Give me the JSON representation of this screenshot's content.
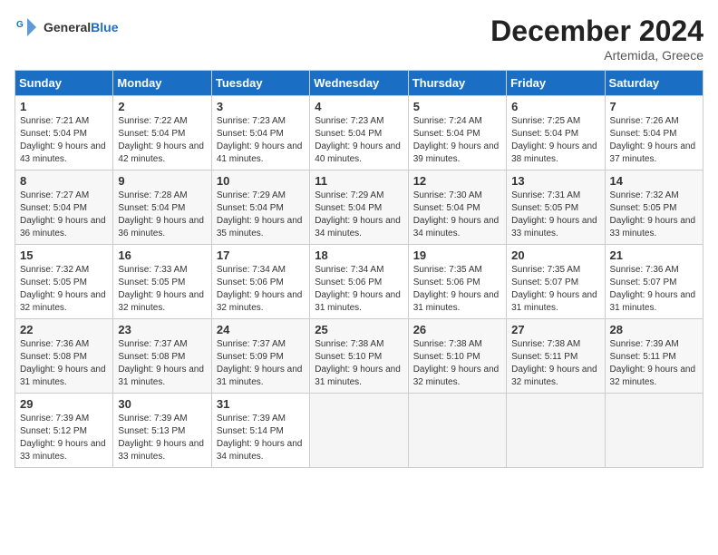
{
  "logo": {
    "text_general": "General",
    "text_blue": "Blue"
  },
  "title": "December 2024",
  "location": "Artemida, Greece",
  "days_of_week": [
    "Sunday",
    "Monday",
    "Tuesday",
    "Wednesday",
    "Thursday",
    "Friday",
    "Saturday"
  ],
  "weeks": [
    [
      {
        "day": "1",
        "sunrise": "7:21 AM",
        "sunset": "5:04 PM",
        "daylight": "9 hours and 43 minutes."
      },
      {
        "day": "2",
        "sunrise": "7:22 AM",
        "sunset": "5:04 PM",
        "daylight": "9 hours and 42 minutes."
      },
      {
        "day": "3",
        "sunrise": "7:23 AM",
        "sunset": "5:04 PM",
        "daylight": "9 hours and 41 minutes."
      },
      {
        "day": "4",
        "sunrise": "7:23 AM",
        "sunset": "5:04 PM",
        "daylight": "9 hours and 40 minutes."
      },
      {
        "day": "5",
        "sunrise": "7:24 AM",
        "sunset": "5:04 PM",
        "daylight": "9 hours and 39 minutes."
      },
      {
        "day": "6",
        "sunrise": "7:25 AM",
        "sunset": "5:04 PM",
        "daylight": "9 hours and 38 minutes."
      },
      {
        "day": "7",
        "sunrise": "7:26 AM",
        "sunset": "5:04 PM",
        "daylight": "9 hours and 37 minutes."
      }
    ],
    [
      {
        "day": "8",
        "sunrise": "7:27 AM",
        "sunset": "5:04 PM",
        "daylight": "9 hours and 36 minutes."
      },
      {
        "day": "9",
        "sunrise": "7:28 AM",
        "sunset": "5:04 PM",
        "daylight": "9 hours and 36 minutes."
      },
      {
        "day": "10",
        "sunrise": "7:29 AM",
        "sunset": "5:04 PM",
        "daylight": "9 hours and 35 minutes."
      },
      {
        "day": "11",
        "sunrise": "7:29 AM",
        "sunset": "5:04 PM",
        "daylight": "9 hours and 34 minutes."
      },
      {
        "day": "12",
        "sunrise": "7:30 AM",
        "sunset": "5:04 PM",
        "daylight": "9 hours and 34 minutes."
      },
      {
        "day": "13",
        "sunrise": "7:31 AM",
        "sunset": "5:05 PM",
        "daylight": "9 hours and 33 minutes."
      },
      {
        "day": "14",
        "sunrise": "7:32 AM",
        "sunset": "5:05 PM",
        "daylight": "9 hours and 33 minutes."
      }
    ],
    [
      {
        "day": "15",
        "sunrise": "7:32 AM",
        "sunset": "5:05 PM",
        "daylight": "9 hours and 32 minutes."
      },
      {
        "day": "16",
        "sunrise": "7:33 AM",
        "sunset": "5:05 PM",
        "daylight": "9 hours and 32 minutes."
      },
      {
        "day": "17",
        "sunrise": "7:34 AM",
        "sunset": "5:06 PM",
        "daylight": "9 hours and 32 minutes."
      },
      {
        "day": "18",
        "sunrise": "7:34 AM",
        "sunset": "5:06 PM",
        "daylight": "9 hours and 31 minutes."
      },
      {
        "day": "19",
        "sunrise": "7:35 AM",
        "sunset": "5:06 PM",
        "daylight": "9 hours and 31 minutes."
      },
      {
        "day": "20",
        "sunrise": "7:35 AM",
        "sunset": "5:07 PM",
        "daylight": "9 hours and 31 minutes."
      },
      {
        "day": "21",
        "sunrise": "7:36 AM",
        "sunset": "5:07 PM",
        "daylight": "9 hours and 31 minutes."
      }
    ],
    [
      {
        "day": "22",
        "sunrise": "7:36 AM",
        "sunset": "5:08 PM",
        "daylight": "9 hours and 31 minutes."
      },
      {
        "day": "23",
        "sunrise": "7:37 AM",
        "sunset": "5:08 PM",
        "daylight": "9 hours and 31 minutes."
      },
      {
        "day": "24",
        "sunrise": "7:37 AM",
        "sunset": "5:09 PM",
        "daylight": "9 hours and 31 minutes."
      },
      {
        "day": "25",
        "sunrise": "7:38 AM",
        "sunset": "5:10 PM",
        "daylight": "9 hours and 31 minutes."
      },
      {
        "day": "26",
        "sunrise": "7:38 AM",
        "sunset": "5:10 PM",
        "daylight": "9 hours and 32 minutes."
      },
      {
        "day": "27",
        "sunrise": "7:38 AM",
        "sunset": "5:11 PM",
        "daylight": "9 hours and 32 minutes."
      },
      {
        "day": "28",
        "sunrise": "7:39 AM",
        "sunset": "5:11 PM",
        "daylight": "9 hours and 32 minutes."
      }
    ],
    [
      {
        "day": "29",
        "sunrise": "7:39 AM",
        "sunset": "5:12 PM",
        "daylight": "9 hours and 33 minutes."
      },
      {
        "day": "30",
        "sunrise": "7:39 AM",
        "sunset": "5:13 PM",
        "daylight": "9 hours and 33 minutes."
      },
      {
        "day": "31",
        "sunrise": "7:39 AM",
        "sunset": "5:14 PM",
        "daylight": "9 hours and 34 minutes."
      },
      null,
      null,
      null,
      null
    ]
  ]
}
